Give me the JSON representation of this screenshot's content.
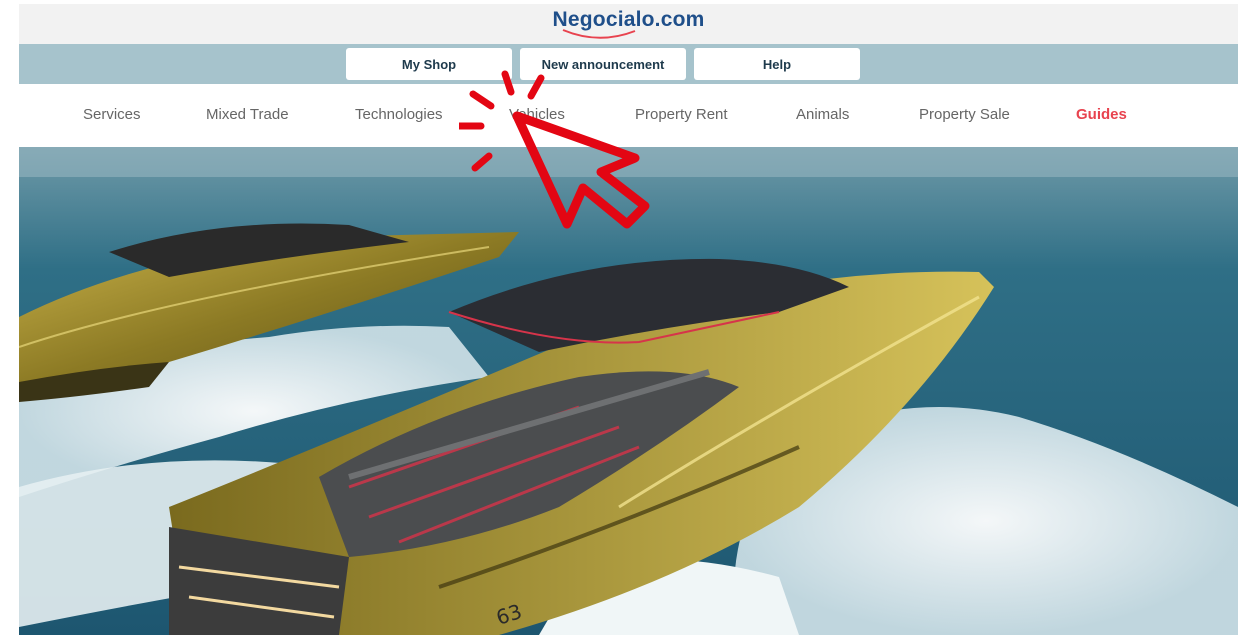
{
  "site": {
    "logo_text": "Negocialo.com"
  },
  "actions": [
    {
      "label": "My Shop"
    },
    {
      "label": "New announcement"
    },
    {
      "label": "Help"
    }
  ],
  "nav": {
    "items": [
      {
        "label": "Services"
      },
      {
        "label": "Mixed Trade"
      },
      {
        "label": "Technologies"
      },
      {
        "label": "Vehicles"
      },
      {
        "label": "Property Rent"
      },
      {
        "label": "Animals"
      },
      {
        "label": "Property Sale"
      },
      {
        "label": "Guides"
      }
    ],
    "active_index": 7
  },
  "hero": {
    "image": "yacht-photo",
    "hull_number": "63"
  },
  "overlay": {
    "icon": "click-cursor-icon",
    "color": "#e30613"
  },
  "colors": {
    "brand_blue": "#1f4f8a",
    "accent_red": "#e8434f",
    "action_bar": "#a6c3cc"
  }
}
